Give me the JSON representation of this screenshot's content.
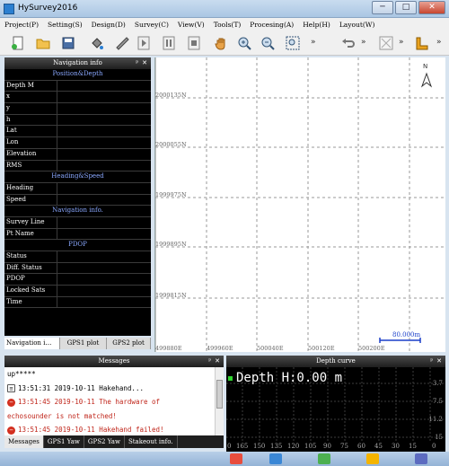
{
  "window": {
    "title": "HySurvey2016",
    "minimize": "─",
    "restore": "□",
    "close": "✕"
  },
  "menu": [
    "Project(P)",
    "Setting(S)",
    "Design(D)",
    "Survey(C)",
    "View(V)",
    "Tools(T)",
    "Procesing(A)",
    "Help(H)",
    "Layout(W)"
  ],
  "toolbar": {
    "icons": [
      "new-file-icon",
      "open-folder-icon",
      "save-icon",
      "paint-bucket-icon",
      "ruler-icon",
      "play-icon",
      "pause-icon",
      "stop-icon",
      "pan-hand-icon",
      "zoom-in-icon",
      "zoom-out-icon",
      "zoom-extent-icon",
      "undo-icon",
      "clear-icon",
      "corner-ruler-icon"
    ],
    "overflow": "»"
  },
  "nav_panel": {
    "title": "Navigation info",
    "pin": "ᵖ",
    "close": "✕",
    "rows": [
      {
        "label": "Position&Depth",
        "section": true
      },
      {
        "label": "Depth M"
      },
      {
        "label": "x"
      },
      {
        "label": "y"
      },
      {
        "label": "h"
      },
      {
        "label": "Lat"
      },
      {
        "label": "Lon"
      },
      {
        "label": "Elevation"
      },
      {
        "label": "RMS"
      },
      {
        "label": "Heading&Speed",
        "section": true
      },
      {
        "label": "Heading"
      },
      {
        "label": "Speed"
      },
      {
        "label": "Navigation info.",
        "section": true
      },
      {
        "label": "Survey Line"
      },
      {
        "label": "Pt Name"
      },
      {
        "label": "PDOP",
        "section": true
      },
      {
        "label": "Status"
      },
      {
        "label": "Diff. Status"
      },
      {
        "label": "PDOP"
      },
      {
        "label": "Locked Sats"
      },
      {
        "label": "Time"
      }
    ],
    "tabs": [
      "Navigation i…",
      "GPS1 plot",
      "GPS2 plot"
    ]
  },
  "map": {
    "y_labels": [
      "2000135N",
      "2000055N",
      "1999975N",
      "1999895N",
      "1999815N"
    ],
    "x_labels": [
      "499880E",
      "499960E",
      "500040E",
      "500120E",
      "500200E"
    ],
    "scale_bar": "80.000m",
    "compass": "N"
  },
  "messages": {
    "title": "Messages",
    "lines": [
      {
        "text": "up*****",
        "type": "plain"
      },
      {
        "text": "13:51:31 2019-10-11  Hakehand...",
        "type": "info"
      },
      {
        "text": "13:51:45 2019-10-11  The hardware of",
        "type": "error"
      },
      {
        "text": "echosounder is not matched!",
        "type": "red"
      },
      {
        "text": "13:51:45 2019-10-11  Hakehand failed!",
        "type": "error"
      }
    ],
    "tabs": [
      "Messages",
      "GPS1 Yaw",
      "GPS2 Yaw",
      "Stakeout info."
    ]
  },
  "depth_curve": {
    "title": "Depth curve",
    "readout": "Depth H:0.00 m",
    "scale": [
      "3.7",
      "7.5",
      "11.2",
      "15"
    ],
    "x_labels": [
      "0",
      "165",
      "150",
      "135",
      "120",
      "105",
      "90",
      "75",
      "60",
      "45",
      "30",
      "15",
      "0"
    ]
  },
  "colors": {
    "title_grad": "#aac6e3",
    "panel_head": "#1e1e1e",
    "section_text": "#8aa8ff",
    "error_red": "#c0261b"
  }
}
